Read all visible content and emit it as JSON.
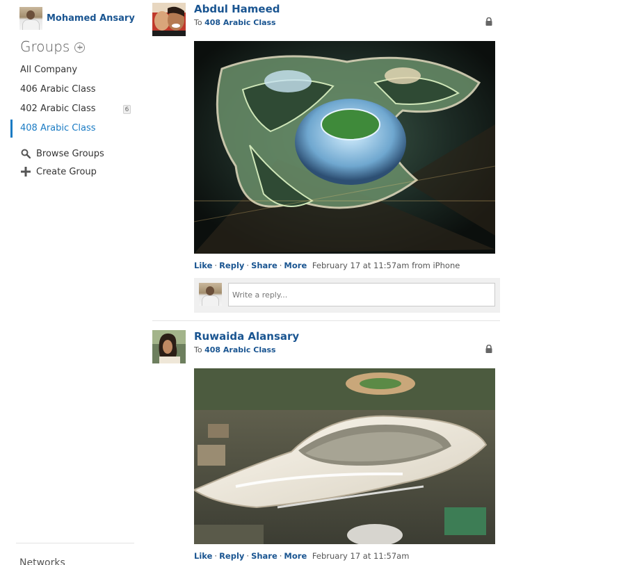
{
  "user": {
    "name": "Mohamed Ansary"
  },
  "sidebar": {
    "groups_title": "Groups",
    "groups": [
      {
        "label": "All Company",
        "badge": ""
      },
      {
        "label": "406 Arabic Class",
        "badge": ""
      },
      {
        "label": "402 Arabic Class",
        "badge": "6"
      },
      {
        "label": "408 Arabic Class",
        "badge": "",
        "active": true
      }
    ],
    "actions": [
      {
        "label": "Browse Groups",
        "icon": "search-icon"
      },
      {
        "label": "Create Group",
        "icon": "plus-icon"
      }
    ],
    "networks_label": "Networks"
  },
  "posts": [
    {
      "author": "Abdul Hameed",
      "to_prefix": "To",
      "group": "408 Arabic Class",
      "actions": [
        "Like",
        "Reply",
        "Share",
        "More"
      ],
      "timestamp": "February 17 at 11:57am from iPhone",
      "image": "aerial-night-stadium-photo",
      "reply_placeholder": "Write a reply..."
    },
    {
      "author": "Ruwaida Alansary",
      "to_prefix": "To",
      "group": "408 Arabic Class",
      "actions": [
        "Like",
        "Reply",
        "Share",
        "More"
      ],
      "timestamp": "February 17 at 11:57am",
      "image": "aerial-white-stadium-rendering"
    }
  ],
  "colors": {
    "link": "#1a5591",
    "active": "#1a7bc4",
    "text": "#333333"
  }
}
